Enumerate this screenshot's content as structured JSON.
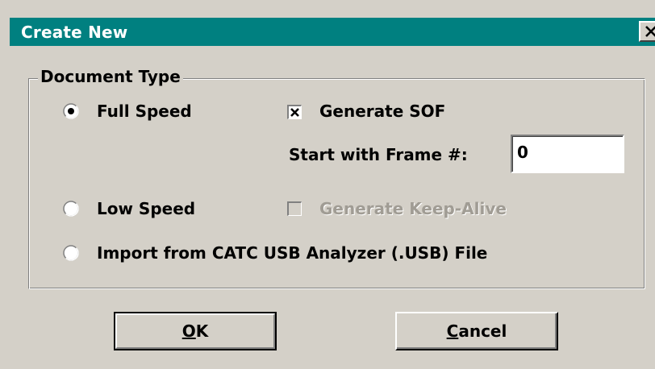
{
  "window": {
    "title": "Create New",
    "close_icon": "close-x-icon",
    "title_bar_color": "#008080",
    "face_color": "#d4d0c8"
  },
  "group": {
    "legend": "Document Type"
  },
  "options": {
    "full_speed": {
      "label": "Full Speed",
      "selected": true
    },
    "low_speed": {
      "label": "Low Speed",
      "selected": false
    },
    "import_usb": {
      "label": "Import from CATC USB Analyzer (.USB) File",
      "selected": false
    }
  },
  "generate_sof": {
    "label": "Generate SOF",
    "checked": true,
    "enabled": true
  },
  "start_frame": {
    "label": "Start with Frame #:",
    "value": "0"
  },
  "generate_keep_alive": {
    "label": "Generate Keep-Alive",
    "checked": false,
    "enabled": false
  },
  "buttons": {
    "ok": {
      "mnemonic": "O",
      "rest": "K"
    },
    "cancel": {
      "mnemonic": "C",
      "rest": "ancel"
    }
  }
}
